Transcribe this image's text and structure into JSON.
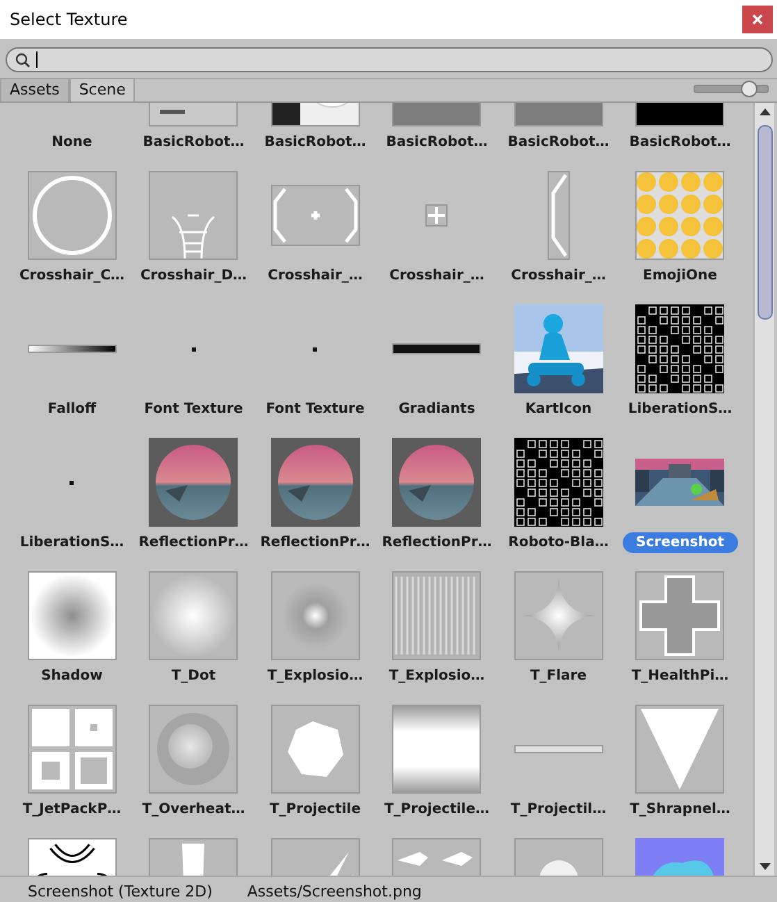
{
  "window": {
    "title": "Select Texture"
  },
  "tabs": [
    {
      "label": "Assets",
      "selected": false
    },
    {
      "label": "Scene",
      "selected": true
    }
  ],
  "zoom_slider": {
    "level": 0.75
  },
  "items": [
    {
      "label": "None",
      "kind": "none",
      "selected": false
    },
    {
      "label": "BasicRobot…",
      "kind": "robot-a",
      "selected": false
    },
    {
      "label": "BasicRobot…",
      "kind": "robot-b",
      "selected": false
    },
    {
      "label": "BasicRobot…",
      "kind": "gray",
      "selected": false
    },
    {
      "label": "BasicRobot…",
      "kind": "gray",
      "selected": false
    },
    {
      "label": "BasicRobot…",
      "kind": "black",
      "selected": false
    },
    {
      "label": "Crosshair_C…",
      "kind": "ring",
      "selected": false
    },
    {
      "label": "Crosshair_D…",
      "kind": "ladder",
      "selected": false
    },
    {
      "label": "Crosshair_…",
      "kind": "brackets",
      "selected": false
    },
    {
      "label": "Crosshair_…",
      "kind": "plus",
      "selected": false
    },
    {
      "label": "Crosshair_…",
      "kind": "tall-bracket",
      "selected": false
    },
    {
      "label": "EmojiOne",
      "kind": "emoji",
      "selected": false
    },
    {
      "label": "Falloff",
      "kind": "falloff",
      "selected": false
    },
    {
      "label": "Font Texture",
      "kind": "dot",
      "selected": false
    },
    {
      "label": "Font Texture",
      "kind": "dot",
      "selected": false
    },
    {
      "label": "Gradiants",
      "kind": "black-bar",
      "selected": false
    },
    {
      "label": "KartIcon",
      "kind": "kart",
      "selected": false
    },
    {
      "label": "LiberationS…",
      "kind": "glyphs",
      "selected": false
    },
    {
      "label": "LiberationS…",
      "kind": "dot",
      "selected": false
    },
    {
      "label": "ReflectionPr…",
      "kind": "sphere",
      "selected": false
    },
    {
      "label": "ReflectionPr…",
      "kind": "sphere",
      "selected": false
    },
    {
      "label": "ReflectionPr…",
      "kind": "sphere",
      "selected": false
    },
    {
      "label": "Roboto-Bla…",
      "kind": "glyphs",
      "selected": false
    },
    {
      "label": "Screenshot",
      "kind": "screenshot",
      "selected": true
    },
    {
      "label": "Shadow",
      "kind": "shadow",
      "selected": false
    },
    {
      "label": "T_Dot",
      "kind": "radial",
      "selected": false
    },
    {
      "label": "T_Explosio…",
      "kind": "radial-small",
      "selected": false
    },
    {
      "label": "T_Explosio…",
      "kind": "streaks",
      "selected": false
    },
    {
      "label": "T_Flare",
      "kind": "flare",
      "selected": false
    },
    {
      "label": "T_HealthPi…",
      "kind": "cross",
      "selected": false
    },
    {
      "label": "T_JetPackP…",
      "kind": "jetpack",
      "selected": false
    },
    {
      "label": "T_Overheat…",
      "kind": "smoke",
      "selected": false
    },
    {
      "label": "T_Projectile",
      "kind": "hexagon",
      "selected": false
    },
    {
      "label": "T_Projectile…",
      "kind": "vgradient",
      "selected": false
    },
    {
      "label": "T_Projectil…",
      "kind": "thin-bar",
      "selected": false
    },
    {
      "label": "T_Shrapnel…",
      "kind": "triangle",
      "selected": false
    },
    {
      "kind": "arcs"
    },
    {
      "kind": "cup"
    },
    {
      "kind": "splash"
    },
    {
      "kind": "sparks"
    },
    {
      "kind": "cloud"
    },
    {
      "kind": "normal"
    }
  ],
  "status_bar": {
    "name": "Screenshot (Texture 2D)",
    "path": "Assets/Screenshot.png"
  }
}
